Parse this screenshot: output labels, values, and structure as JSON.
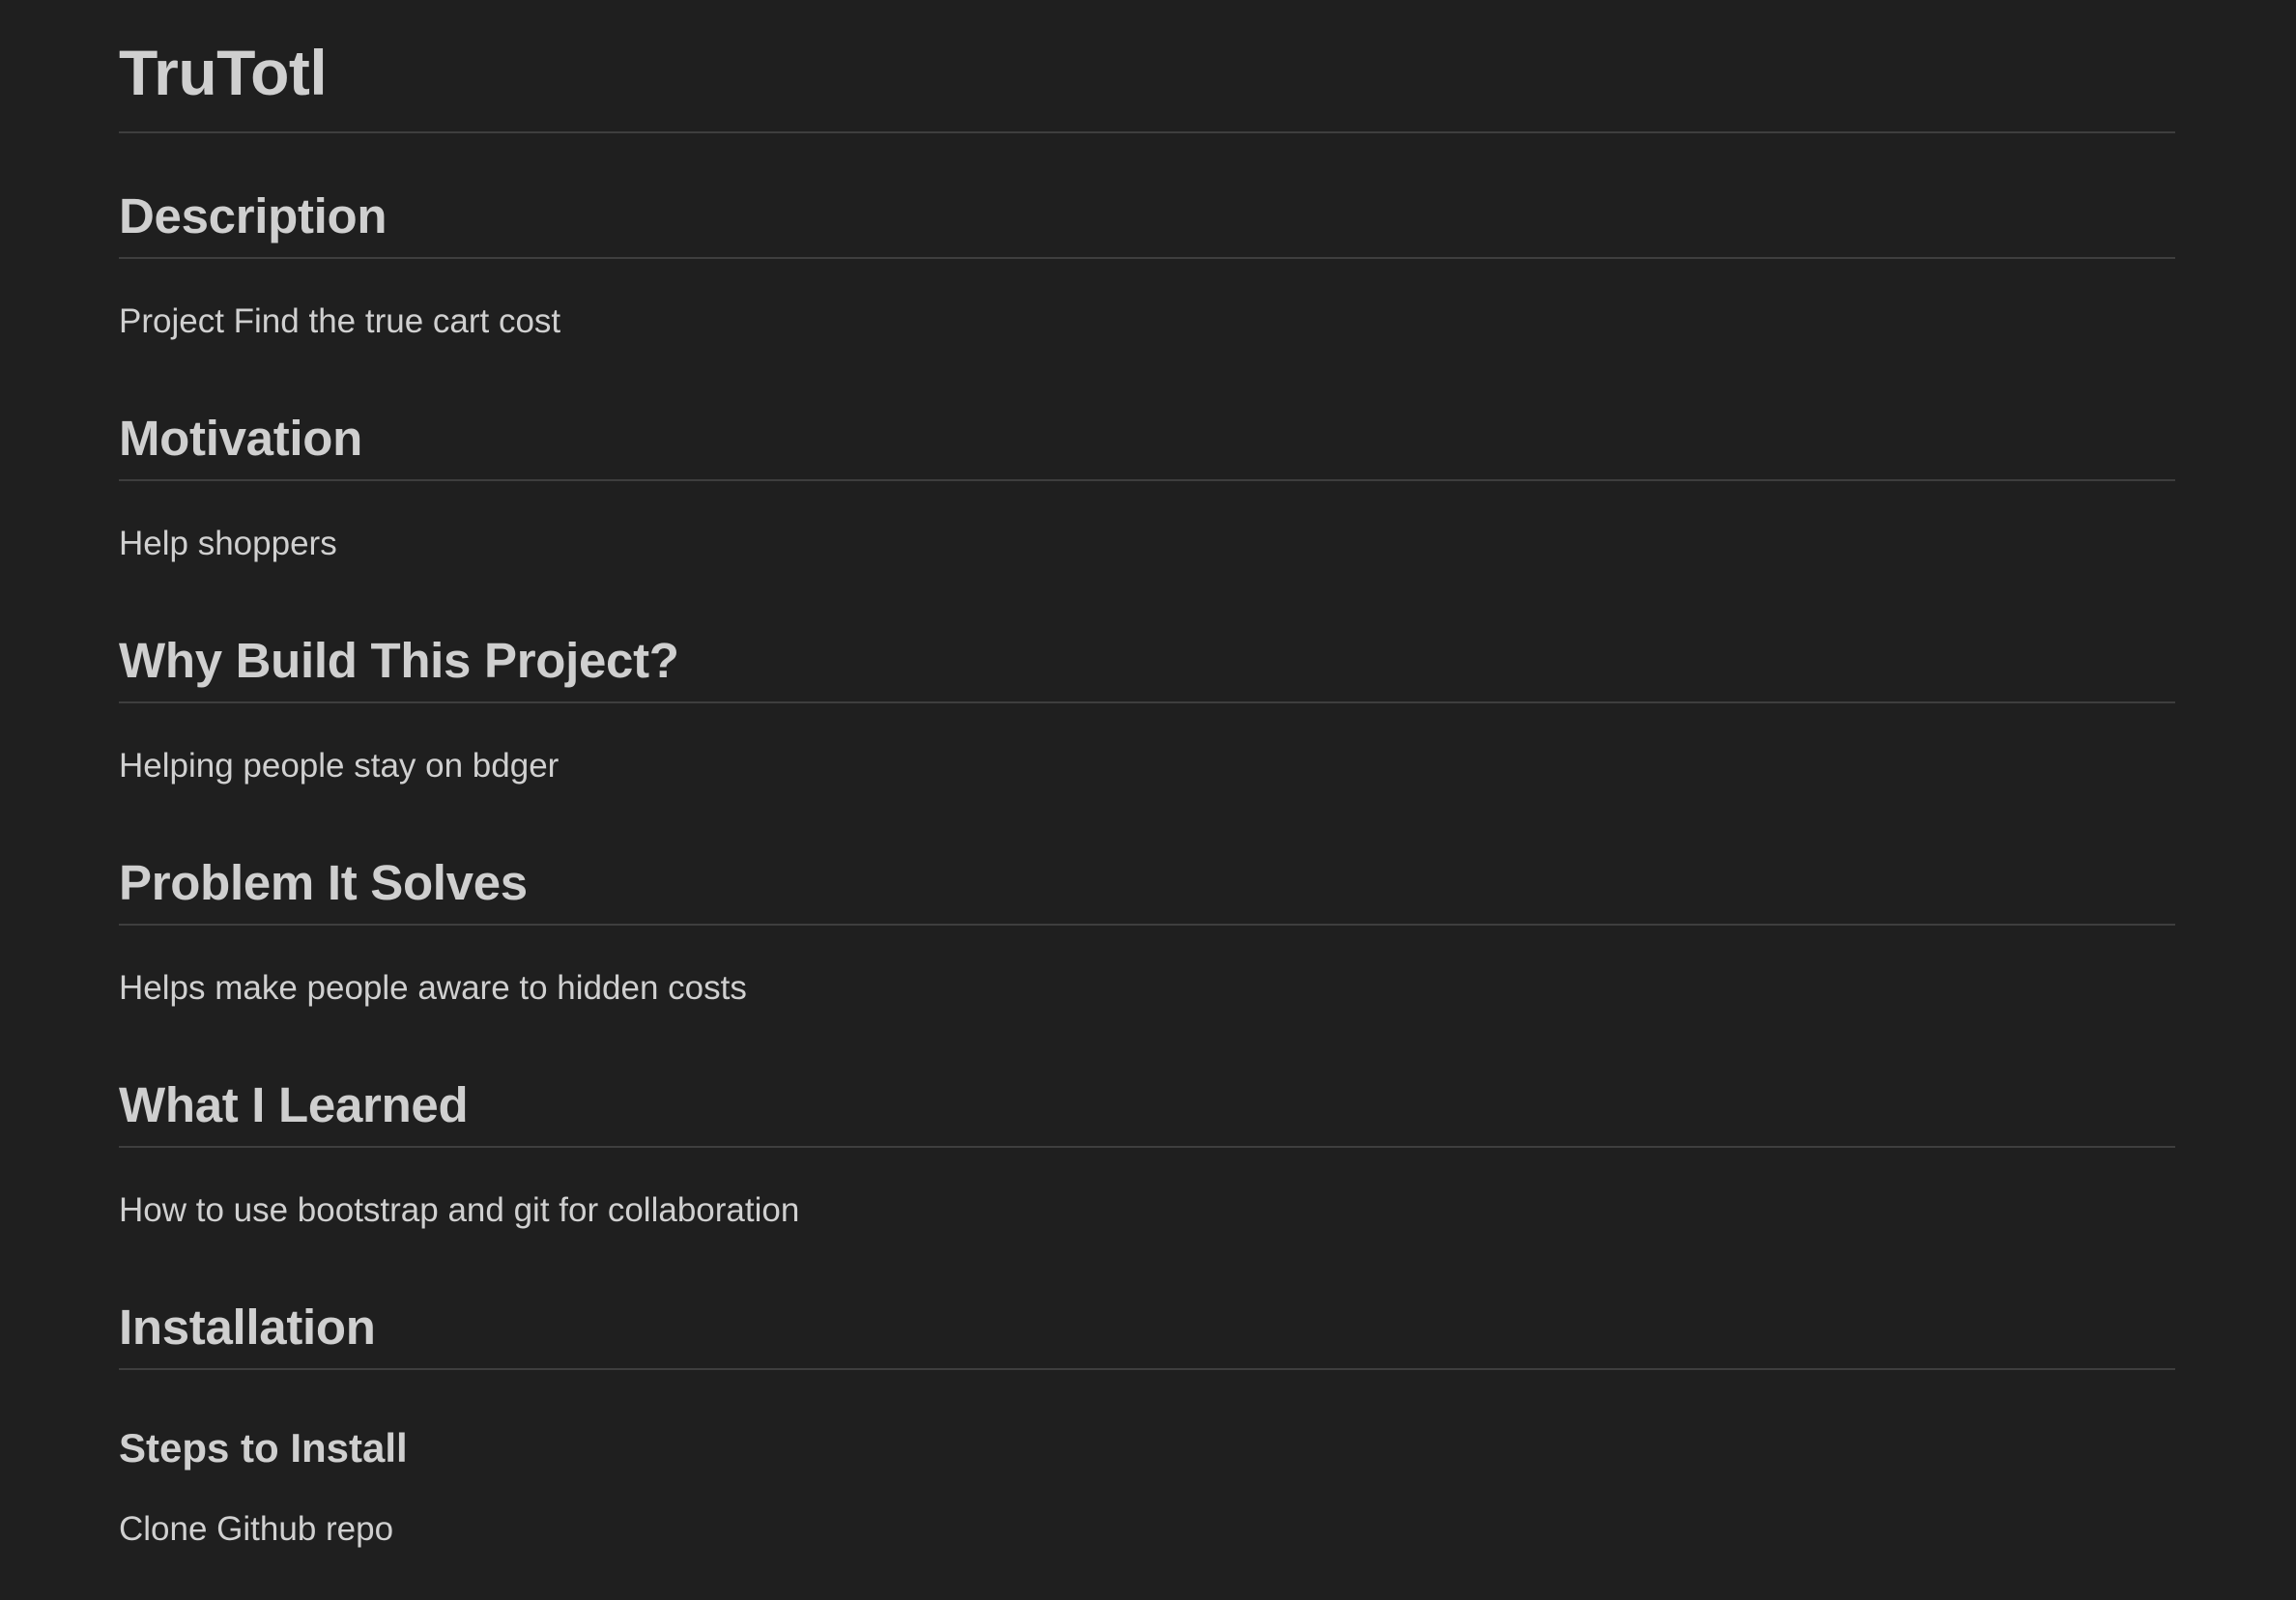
{
  "document": {
    "title": "TruTotl",
    "sections": [
      {
        "heading": "Description",
        "body": "Project Find the true cart cost"
      },
      {
        "heading": "Motivation",
        "body": "Help shoppers"
      },
      {
        "heading": "Why Build This Project?",
        "body": "Helping people stay on bdger"
      },
      {
        "heading": "Problem It Solves",
        "body": "Helps make people aware to hidden costs"
      },
      {
        "heading": "What I Learned",
        "body": "How to use bootstrap and git for collaboration"
      },
      {
        "heading": "Installation"
      }
    ],
    "subsection": {
      "heading": "Steps to Install",
      "body": "Clone Github repo"
    }
  }
}
